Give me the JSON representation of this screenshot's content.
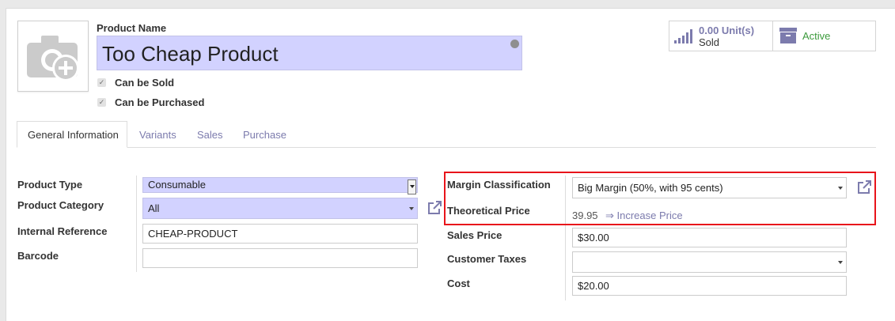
{
  "product": {
    "name_label": "Product Name",
    "name_value": "Too Cheap Product",
    "can_be_sold_label": "Can be Sold",
    "can_be_purchased_label": "Can be Purchased"
  },
  "stats": {
    "units_value": "0.00 Unit(s)",
    "units_caption": "Sold",
    "active_label": "Active"
  },
  "tabs": [
    {
      "label": "General Information"
    },
    {
      "label": "Variants"
    },
    {
      "label": "Sales"
    },
    {
      "label": "Purchase"
    }
  ],
  "left_form": {
    "product_type_label": "Product Type",
    "product_type_value": "Consumable",
    "product_category_label": "Product Category",
    "product_category_value": "All",
    "internal_reference_label": "Internal Reference",
    "internal_reference_value": "CHEAP-PRODUCT",
    "barcode_label": "Barcode",
    "barcode_value": ""
  },
  "right_form": {
    "margin_classification_label": "Margin Classification",
    "margin_classification_value": "Big Margin (50%, with 95 cents)",
    "theoretical_price_label": "Theoretical Price",
    "theoretical_price_value": "39.95",
    "increase_price_link": "⇒ Increase Price",
    "sales_price_label": "Sales Price",
    "sales_price_value": "$30.00",
    "customer_taxes_label": "Customer Taxes",
    "customer_taxes_value": "",
    "cost_label": "Cost",
    "cost_value": "$20.00"
  },
  "colors": {
    "required_field_bg": "#d2d2ff",
    "link": "#7c7bad",
    "highlight_border": "#e8141b",
    "active_status": "#3c9a3c",
    "stat_icon": "#7c7bad"
  }
}
